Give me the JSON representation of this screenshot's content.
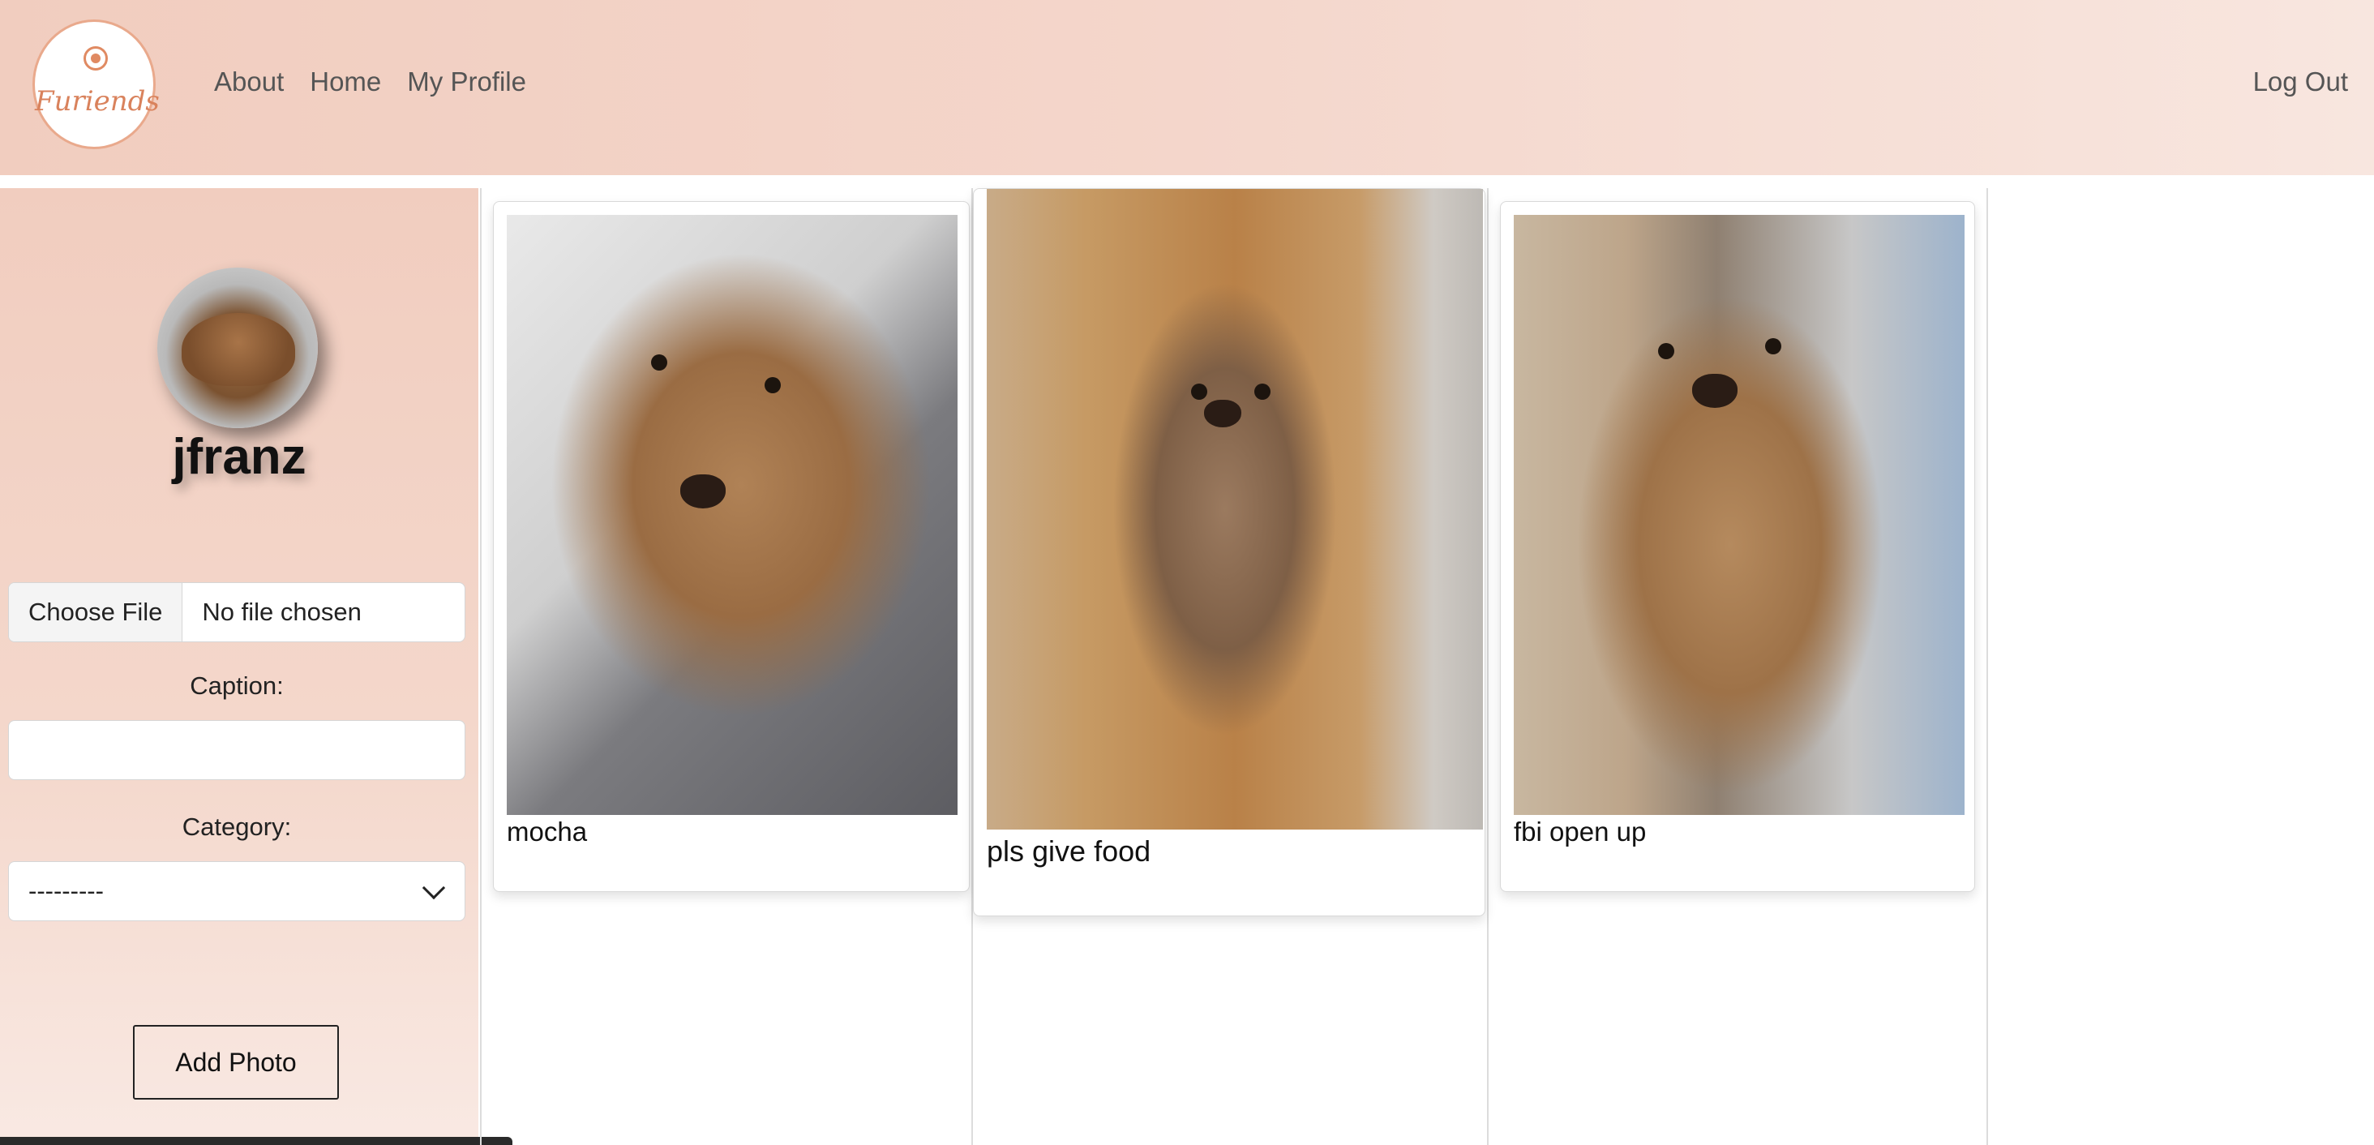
{
  "navbar": {
    "logo_text": "Furiends",
    "links": [
      "About",
      "Home",
      "My Profile"
    ],
    "logout_label": "Log Out"
  },
  "sidebar": {
    "username": "jfranz",
    "file": {
      "button_label": "Choose File",
      "status": "No file chosen"
    },
    "caption_label": "Caption:",
    "caption_value": "",
    "category_label": "Category:",
    "category_selected": "---------",
    "add_button_label": "Add Photo"
  },
  "posts": [
    {
      "caption": "mocha"
    },
    {
      "caption": "pls give food"
    },
    {
      "caption": "fbi open up"
    }
  ],
  "colors": {
    "nav_bg": "#f1cdbf",
    "nav_text": "#555555",
    "logo_accent": "#e08a62"
  }
}
